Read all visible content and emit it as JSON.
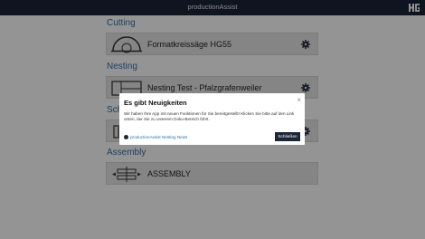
{
  "app": {
    "title": "productionAssist",
    "logo": "hg-logo"
  },
  "sections": [
    {
      "title": "Cutting",
      "card_label": "Formatkreissäge HG55",
      "icon": "saw-icon"
    },
    {
      "title": "Nesting",
      "card_label": "Nesting Test - Pfalzgrafenweiler",
      "icon": "nesting-icon"
    },
    {
      "title": "Sch",
      "card_label": "",
      "icon": "machine-icon"
    },
    {
      "title": "Assembly",
      "card_label": "ASSEMBLY",
      "icon": "assembly-icon"
    }
  ],
  "modal": {
    "title": "Es gibt Neuigkeiten",
    "body": "Wir haben Ihre App mit neuen Funktionen für Sie bereitgestellt! Klicken Sie bitte auf den Link unten, der Sie zu unserem Doku-Bereich führt.",
    "link_label": "productionAssist Nesting News",
    "close_button": "Schließen",
    "close_icon": "×"
  },
  "colors": {
    "topbar": "#1b2538",
    "accent": "#2d6fa8",
    "button": "#1b2538"
  }
}
